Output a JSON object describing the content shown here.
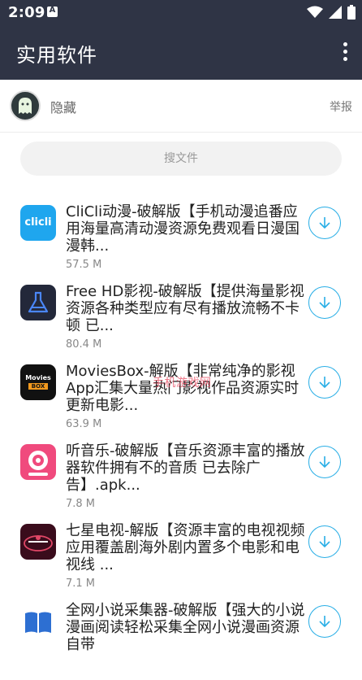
{
  "status": {
    "time": "2:09",
    "notif_letter": "A"
  },
  "appbar": {
    "title": "实用软件"
  },
  "user": {
    "name": "隐藏",
    "report": "举报"
  },
  "search": {
    "placeholder": "搜文件"
  },
  "watermark": "手机游戏网",
  "items": [
    {
      "title": "CliCli动漫-破解版【手机动漫追番应用海量高清动漫资源免费观看日漫国漫韩...",
      "size": "57.5 M",
      "icon": "clicli-logo-icon",
      "logo_text": "clicli"
    },
    {
      "title": "Free HD影视-破解版【提供海量影视资源各种类型应有尽有播放流畅不卡顿 已...",
      "size": "80.4 M",
      "icon": "flask-icon"
    },
    {
      "title": "MoviesBox-解版【非常纯净的影视App汇集大量热门影视作品资源实时更新电影...",
      "size": "63.9 M",
      "icon": "moviesbox-logo-icon",
      "logo_text": "Movies",
      "logo_text2": "BOX"
    },
    {
      "title": "听音乐-破解版【音乐资源丰富的播放器软件拥有不的音质 已去除广告】.apk...",
      "size": "7.8 M",
      "icon": "music-app-icon"
    },
    {
      "title": "七星电视-解版【资源丰富的电视视频应用覆盖剧海外剧内置多个电影和电视线 ...",
      "size": "7.1 M",
      "icon": "qixing-tv-icon"
    },
    {
      "title": "全网小说采集器-破解版【强大的小说漫画阅读轻松采集全网小说漫画资源自带",
      "size": "",
      "icon": "book-icon"
    }
  ]
}
